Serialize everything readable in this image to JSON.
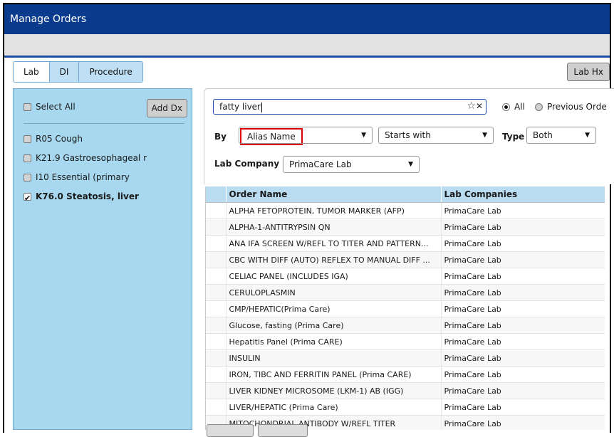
{
  "window": {
    "title": "Manage Orders"
  },
  "tabs": [
    {
      "label": "Lab",
      "active": true
    },
    {
      "label": "DI",
      "active": false
    },
    {
      "label": "Procedure",
      "active": false
    }
  ],
  "lab_hx_label": "Lab Hx",
  "left_panel": {
    "select_all_label": "Select All",
    "add_dx_label": "Add Dx",
    "diagnoses": [
      {
        "label": "R05 Cough",
        "checked": false
      },
      {
        "label": "K21.9 Gastroesophageal r",
        "checked": false
      },
      {
        "label": "I10 Essential (primary",
        "checked": false
      },
      {
        "label": "K76.0 Steatosis, liver",
        "checked": true
      }
    ]
  },
  "search": {
    "query": "fatty liver",
    "radio_all_label": "All",
    "radio_previous_label": "Previous Orde",
    "by_label": "By",
    "by_value": "Alias Name",
    "match_value": "Starts with",
    "type_label": "Type",
    "type_value": "Both",
    "lab_company_label": "Lab Company",
    "lab_company_value": "PrimaCare Lab"
  },
  "grid": {
    "columns": [
      "Order Name",
      "Lab Companies"
    ],
    "rows": [
      [
        "ALPHA FETOPROTEIN, TUMOR MARKER (AFP)",
        "PrimaCare Lab"
      ],
      [
        "ALPHA-1-ANTITRYPSIN QN",
        "PrimaCare Lab"
      ],
      [
        "ANA IFA SCREEN W/REFL TO TITER AND PATTERN...",
        "PrimaCare Lab"
      ],
      [
        "CBC WITH DIFF (AUTO) REFLEX TO MANUAL DIFF ...",
        "PrimaCare Lab"
      ],
      [
        "CELIAC PANEL (INCLUDES IGA)",
        "PrimaCare Lab"
      ],
      [
        "CERULOPLASMIN",
        "PrimaCare Lab"
      ],
      [
        "CMP/HEPATIC(Prima Care)",
        "PrimaCare Lab"
      ],
      [
        "Glucose, fasting (Prima Care)",
        "PrimaCare Lab"
      ],
      [
        "Hepatitis Panel (Prima CARE)",
        "PrimaCare Lab"
      ],
      [
        "INSULIN",
        "PrimaCare Lab"
      ],
      [
        "IRON, TIBC AND FERRITIN PANEL (Prima CARE)",
        "PrimaCare Lab"
      ],
      [
        "LIVER KIDNEY MICROSOME (LKM-1) AB (IGG)",
        "PrimaCare Lab"
      ],
      [
        "LIVER/HEPATIC (Prima Care)",
        "PrimaCare Lab"
      ],
      [
        "MITOCHONDRIAL ANTIBODY W/REFL TITER",
        "PrimaCare Lab"
      ]
    ]
  },
  "colors": {
    "title_bar": "#0b3b8c",
    "panel_blue": "#a8d8ef",
    "header_blue": "#b9dcf1",
    "highlight_red": "#e00000"
  }
}
